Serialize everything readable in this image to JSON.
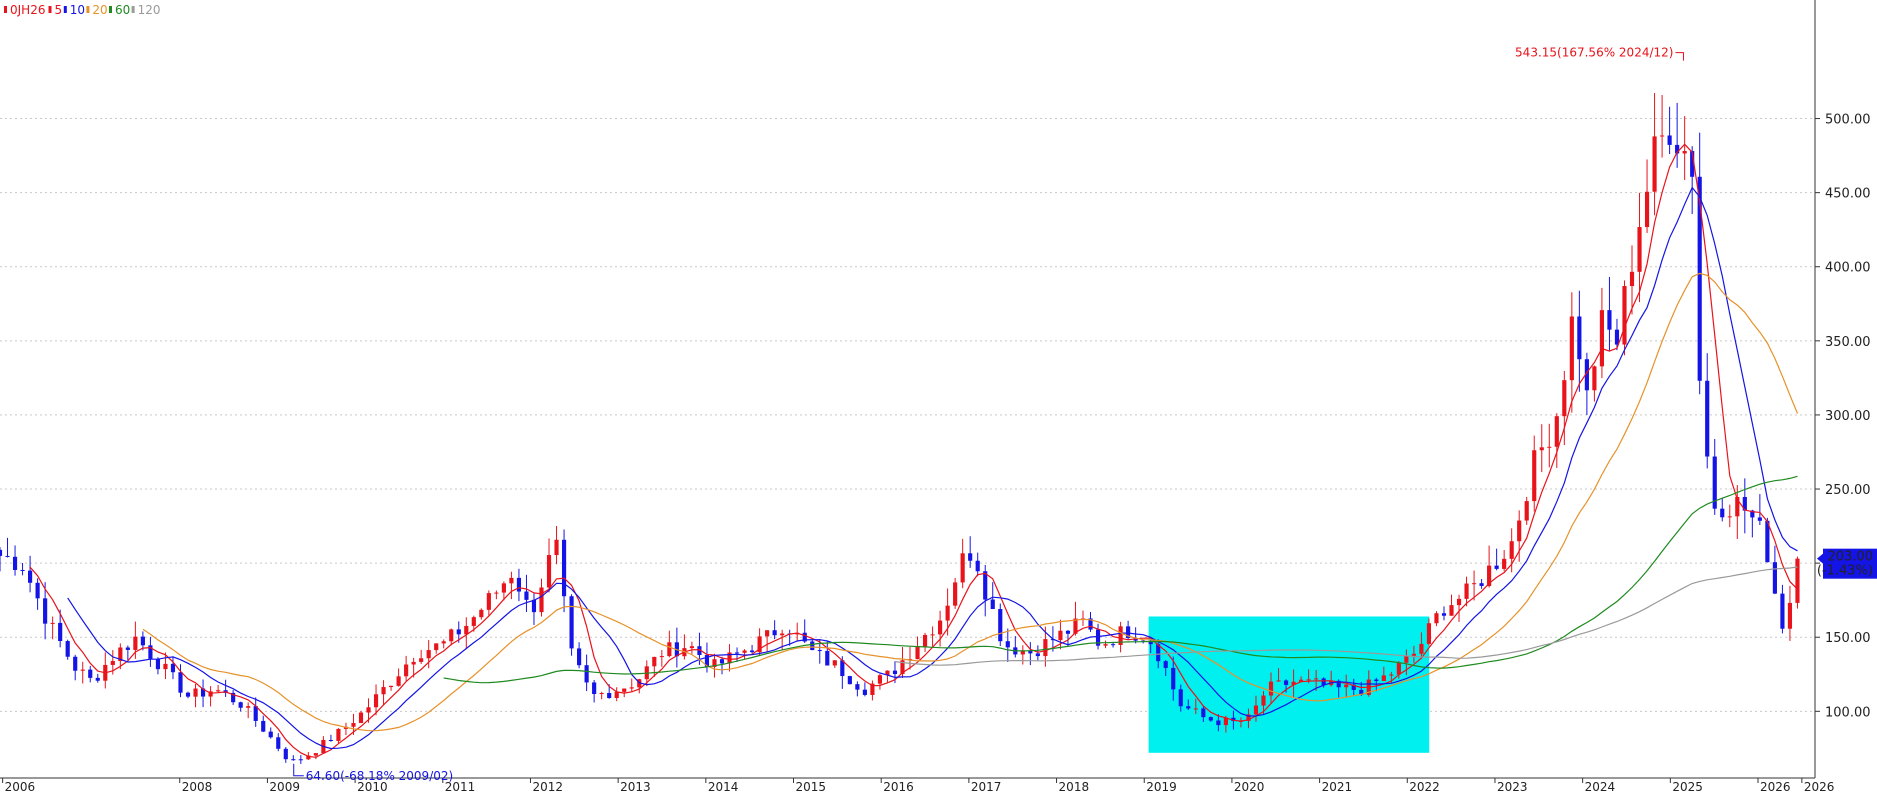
{
  "chart_data": {
    "type": "candlestick",
    "symbol": "0JH26",
    "legend": [
      {
        "label": "0JH26",
        "color": "#e8131b"
      },
      {
        "label": "5",
        "color": "#e8131b"
      },
      {
        "label": "10",
        "color": "#1414e6"
      },
      {
        "label": "20",
        "color": "#e6922a"
      },
      {
        "label": "60",
        "color": "#1f8a1f"
      },
      {
        "label": "120",
        "color": "#9a9a9a"
      }
    ],
    "x_ticks": [
      "2006",
      "2008",
      "2009",
      "2010",
      "2011",
      "2012",
      "2013",
      "2014",
      "2015",
      "2016",
      "2017",
      "2018",
      "2019",
      "2020",
      "2021",
      "2022",
      "2023",
      "2024",
      "2025",
      "2026",
      "2026"
    ],
    "y_ticks": [
      "100.00",
      "150.00",
      "200.00",
      "250.00",
      "300.00",
      "350.00",
      "400.00",
      "450.00",
      "500.00"
    ],
    "ylim": [
      55,
      580
    ],
    "xlim": [
      2005.75,
      2026.45
    ],
    "last_price": "203.00",
    "last_change": "(-1.43%)",
    "annotations": {
      "high": {
        "text": "543.15(167.56% 2024/12)",
        "x": 2024.95,
        "y": 543.15
      },
      "low": {
        "text": "64.60(-68.18% 2009/02)",
        "x": 2009.1,
        "y": 64.6
      }
    },
    "highlight_zone": {
      "x0": 2018.85,
      "x1": 2022.05,
      "y0": 72,
      "y1": 164
    },
    "price_path": [
      [
        2005.75,
        205
      ],
      [
        2006.0,
        200
      ],
      [
        2006.3,
        160
      ],
      [
        2006.6,
        130
      ],
      [
        2006.8,
        120
      ],
      [
        2007.0,
        135
      ],
      [
        2007.3,
        150
      ],
      [
        2007.6,
        130
      ],
      [
        2007.9,
        110
      ],
      [
        2008.2,
        115
      ],
      [
        2008.5,
        105
      ],
      [
        2008.8,
        85
      ],
      [
        2009.0,
        70
      ],
      [
        2009.1,
        66
      ],
      [
        2009.3,
        72
      ],
      [
        2009.6,
        85
      ],
      [
        2009.9,
        100
      ],
      [
        2010.2,
        120
      ],
      [
        2010.5,
        140
      ],
      [
        2010.8,
        145
      ],
      [
        2011.1,
        160
      ],
      [
        2011.4,
        180
      ],
      [
        2011.6,
        195
      ],
      [
        2011.8,
        165
      ],
      [
        2012.0,
        200
      ],
      [
        2012.1,
        210
      ],
      [
        2012.25,
        140
      ],
      [
        2012.5,
        110
      ],
      [
        2012.8,
        115
      ],
      [
        2013.0,
        120
      ],
      [
        2013.3,
        140
      ],
      [
        2013.6,
        145
      ],
      [
        2013.9,
        130
      ],
      [
        2014.2,
        140
      ],
      [
        2014.5,
        150
      ],
      [
        2014.7,
        160
      ],
      [
        2015.0,
        140
      ],
      [
        2015.3,
        130
      ],
      [
        2015.6,
        115
      ],
      [
        2015.9,
        125
      ],
      [
        2016.2,
        145
      ],
      [
        2016.5,
        165
      ],
      [
        2016.7,
        200
      ],
      [
        2016.85,
        210
      ],
      [
        2017.0,
        180
      ],
      [
        2017.2,
        145
      ],
      [
        2017.5,
        140
      ],
      [
        2017.8,
        150
      ],
      [
        2018.1,
        160
      ],
      [
        2018.3,
        145
      ],
      [
        2018.6,
        155
      ],
      [
        2018.85,
        150
      ],
      [
        2019.0,
        135
      ],
      [
        2019.2,
        105
      ],
      [
        2019.5,
        95
      ],
      [
        2019.8,
        92
      ],
      [
        2020.0,
        95
      ],
      [
        2020.2,
        115
      ],
      [
        2020.5,
        120
      ],
      [
        2020.8,
        118
      ],
      [
        2021.0,
        115
      ],
      [
        2021.3,
        115
      ],
      [
        2021.6,
        125
      ],
      [
        2021.9,
        140
      ],
      [
        2022.0,
        150
      ],
      [
        2022.2,
        170
      ],
      [
        2022.5,
        180
      ],
      [
        2022.8,
        200
      ],
      [
        2023.0,
        215
      ],
      [
        2023.2,
        260
      ],
      [
        2023.5,
        300
      ],
      [
        2023.7,
        370
      ],
      [
        2023.85,
        310
      ],
      [
        2024.0,
        360
      ],
      [
        2024.2,
        350
      ],
      [
        2024.4,
        420
      ],
      [
        2024.6,
        470
      ],
      [
        2024.8,
        500
      ],
      [
        2024.95,
        480
      ],
      [
        2025.05,
        470
      ],
      [
        2025.15,
        300
      ],
      [
        2025.3,
        240
      ],
      [
        2025.6,
        240
      ],
      [
        2025.8,
        225
      ],
      [
        2025.95,
        200
      ],
      [
        2026.05,
        155
      ],
      [
        2026.15,
        170
      ],
      [
        2026.25,
        203
      ]
    ],
    "ma_windows": [
      5,
      10,
      20,
      60,
      120
    ],
    "ma_colors": [
      "#e8131b",
      "#1414e6",
      "#e6922a",
      "#1f8a1f",
      "#9a9a9a"
    ]
  }
}
